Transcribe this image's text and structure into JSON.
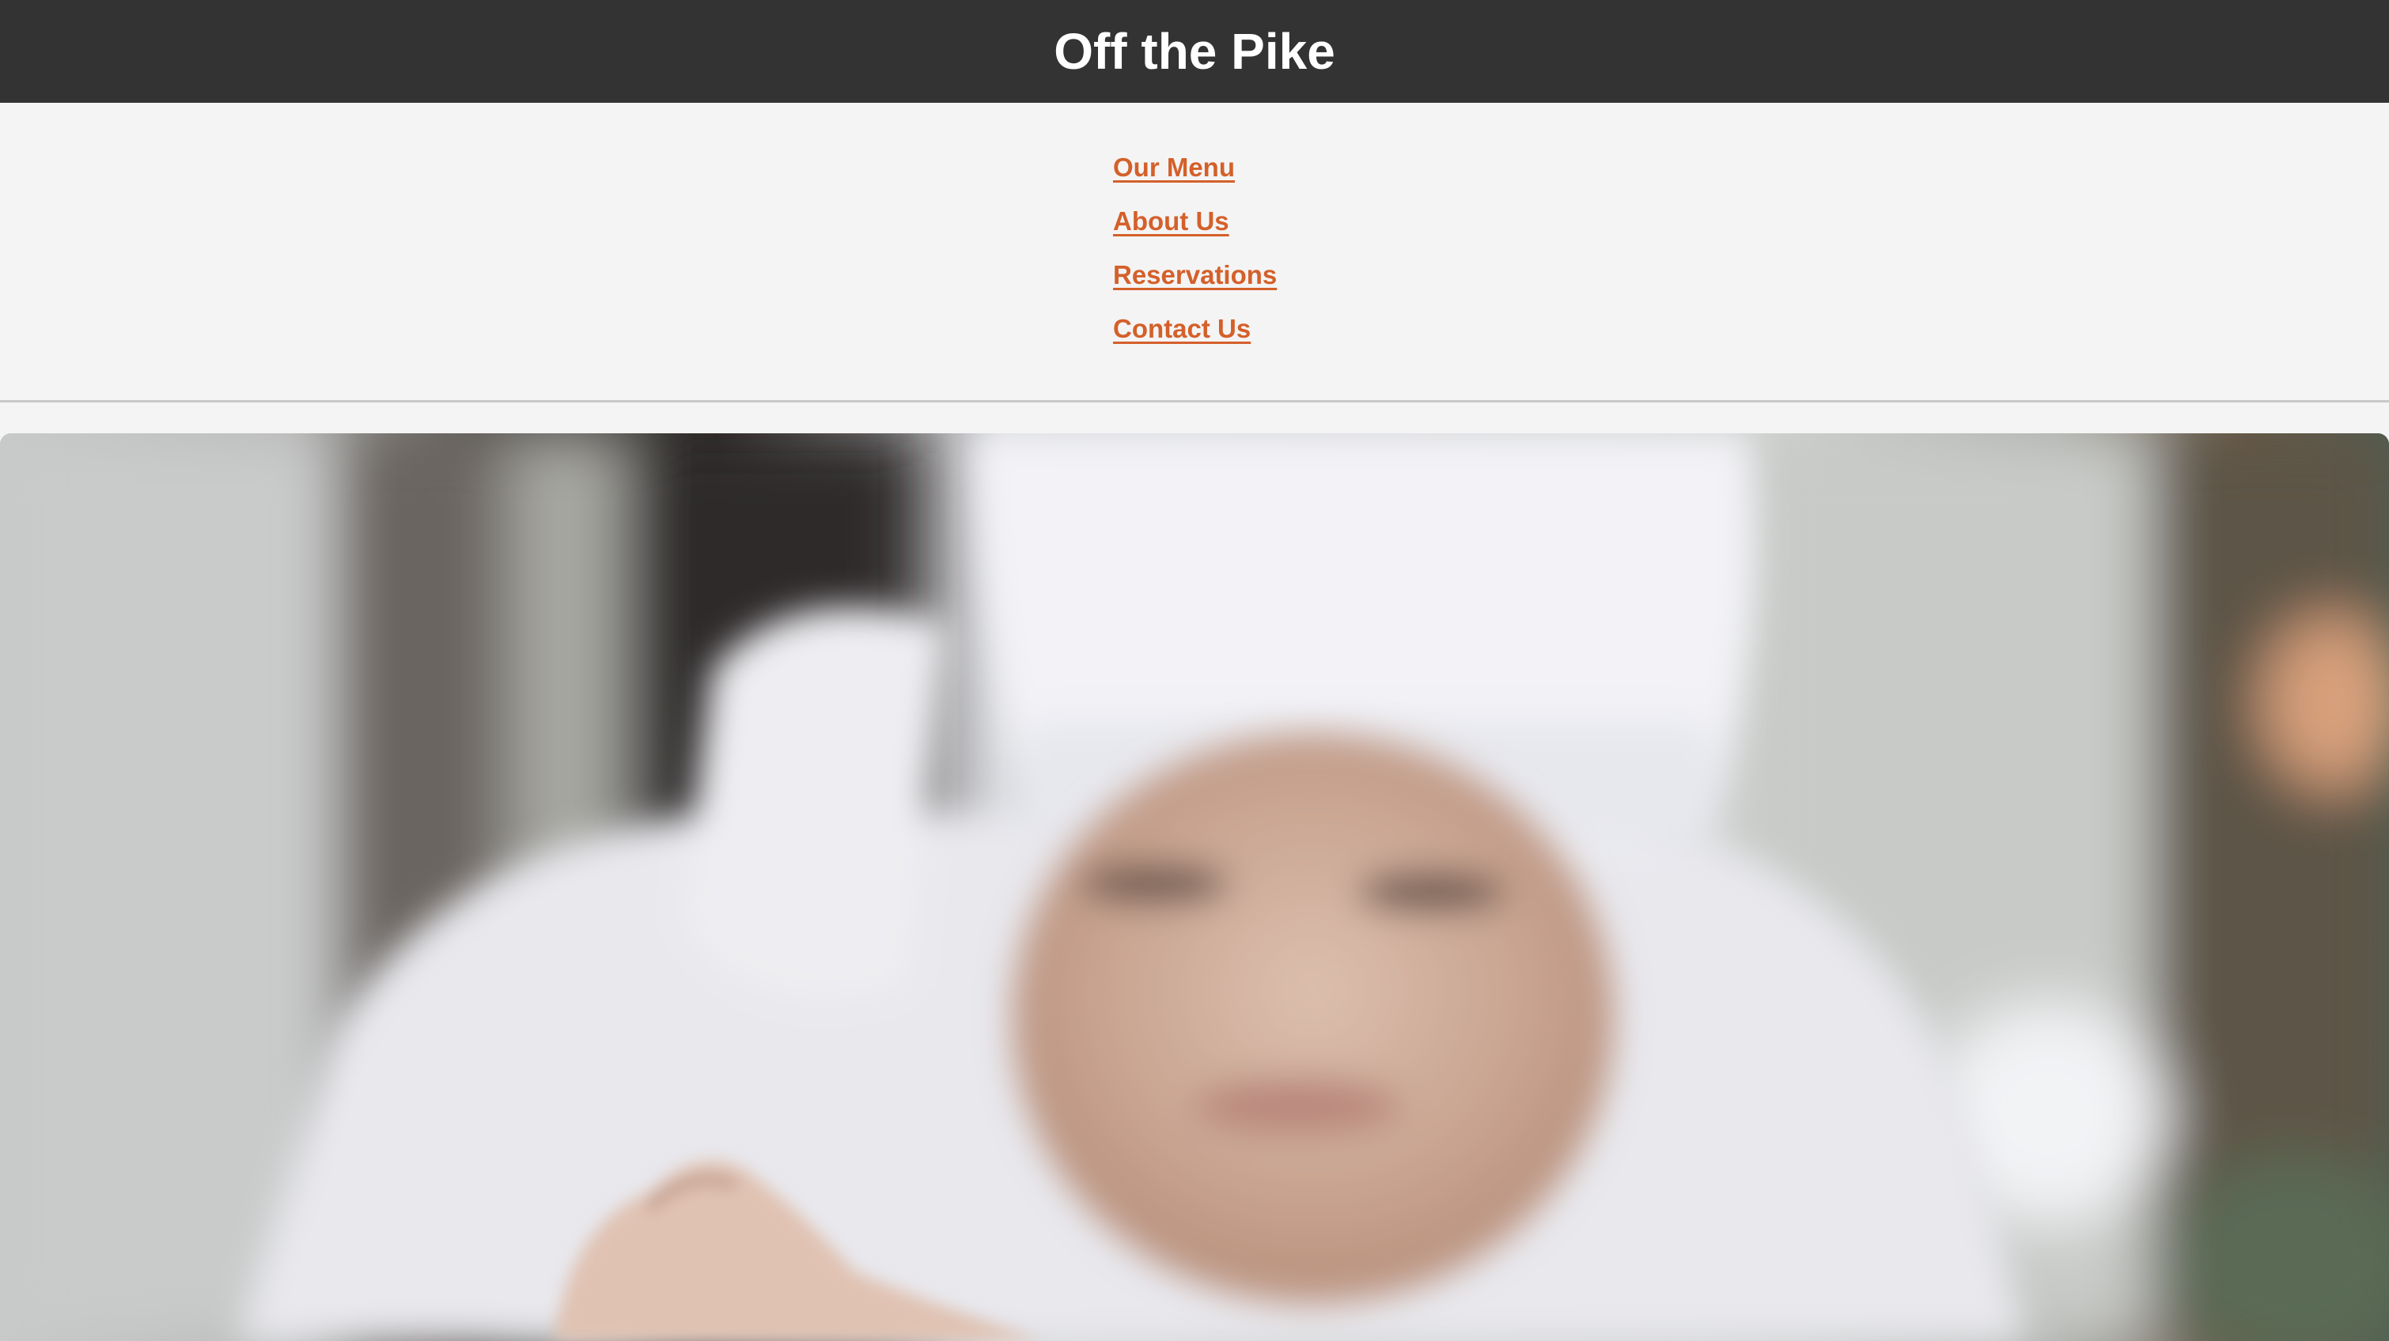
{
  "header": {
    "title": "Off the Pike",
    "background": "#333333"
  },
  "nav": {
    "link_color": "#d4602a",
    "items": [
      {
        "label": "Our Menu"
      },
      {
        "label": "About Us"
      },
      {
        "label": "Reservations"
      },
      {
        "label": "Contact Us"
      }
    ]
  },
  "hero": {
    "image": "chef-photo"
  }
}
